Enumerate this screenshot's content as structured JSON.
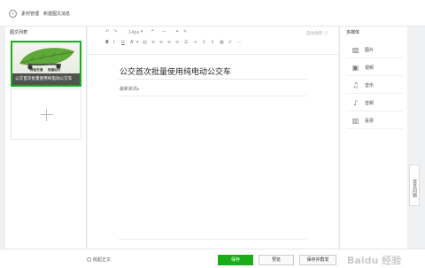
{
  "header": {
    "breadcrumb_home": "素材管理",
    "breadcrumb_current": "新建图文消息"
  },
  "article_list": {
    "title": "图文列表",
    "item_caption": "公交首次批量使用纯电动公交车",
    "thumb_banner_left": "绿色交通",
    "thumb_banner_right": "低碳出行"
  },
  "editor": {
    "toolbar": {
      "font_size": "14px",
      "autosave": "自动保存"
    },
    "title": "公交首次批量使用纯电动公交车",
    "author": "最新资讯"
  },
  "multimedia": {
    "title": "多媒体",
    "items": [
      {
        "label": "图片",
        "icon": "image-icon"
      },
      {
        "label": "视频",
        "icon": "video-icon"
      },
      {
        "label": "音乐",
        "icon": "music-icon"
      },
      {
        "label": "音频",
        "icon": "audio-icon"
      },
      {
        "label": "投票",
        "icon": "vote-icon"
      }
    ]
  },
  "help_tab": "常见问题",
  "footer": {
    "collect_label": "收起正文",
    "save": "保存",
    "preview": "预览",
    "save_and_send": "保存并群发"
  },
  "watermark": "Baidu 经验",
  "colors": {
    "accent": "#1aad19"
  }
}
